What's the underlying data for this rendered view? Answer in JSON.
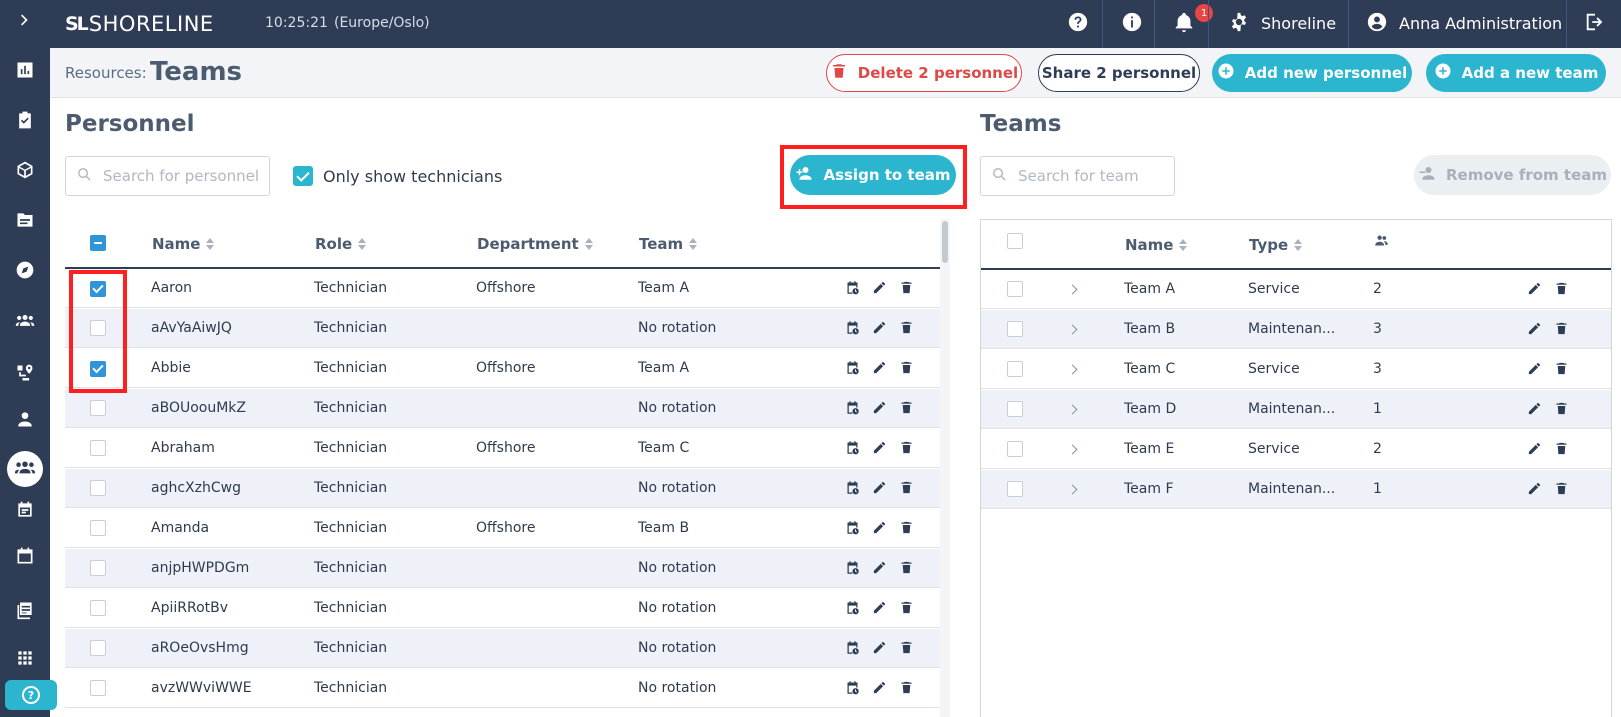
{
  "header": {
    "brand": "SHORELINE",
    "logo_mark": "SL",
    "time": "10:25:21",
    "timezone": "(Europe/Oslo)",
    "notification_count": "1",
    "org_name": "Shoreline",
    "user_name": "Anna Administration"
  },
  "page": {
    "breadcrumb_label": "Resources:",
    "title": "Teams"
  },
  "actions": {
    "delete_label": "Delete 2 personnel",
    "share_label": "Share 2 personnel",
    "add_personnel_label": "Add new personnel",
    "add_team_label": "Add a new team"
  },
  "personnel": {
    "title": "Personnel",
    "search_placeholder": "Search for personnel",
    "only_technicians_label": "Only show technicians",
    "assign_label": "Assign to team",
    "columns": {
      "name": "Name",
      "role": "Role",
      "department": "Department",
      "team": "Team"
    },
    "rows": [
      {
        "name": "Aaron",
        "role": "Technician",
        "department": "Offshore",
        "team": "Team A",
        "checked": true
      },
      {
        "name": "aAvYaAiwJQ",
        "role": "Technician",
        "department": "",
        "team": "No rotation",
        "checked": false
      },
      {
        "name": "Abbie",
        "role": "Technician",
        "department": "Offshore",
        "team": "Team A",
        "checked": true
      },
      {
        "name": "aBOUoouMkZ",
        "role": "Technician",
        "department": "",
        "team": "No rotation",
        "checked": false
      },
      {
        "name": "Abraham",
        "role": "Technician",
        "department": "Offshore",
        "team": "Team C",
        "checked": false
      },
      {
        "name": "aghcXzhCwg",
        "role": "Technician",
        "department": "",
        "team": "No rotation",
        "checked": false
      },
      {
        "name": "Amanda",
        "role": "Technician",
        "department": "Offshore",
        "team": "Team B",
        "checked": false
      },
      {
        "name": "anjpHWPDGm",
        "role": "Technician",
        "department": "",
        "team": "No rotation",
        "checked": false
      },
      {
        "name": "ApiiRRotBv",
        "role": "Technician",
        "department": "",
        "team": "No rotation",
        "checked": false
      },
      {
        "name": "aROeOvsHmg",
        "role": "Technician",
        "department": "",
        "team": "No rotation",
        "checked": false
      },
      {
        "name": "avzWWviWWE",
        "role": "Technician",
        "department": "",
        "team": "No rotation",
        "checked": false
      }
    ]
  },
  "teams": {
    "title": "Teams",
    "search_placeholder": "Search for team",
    "remove_label": "Remove from team",
    "columns": {
      "name": "Name",
      "type": "Type"
    },
    "rows": [
      {
        "name": "Team A",
        "type": "Service",
        "count": "2"
      },
      {
        "name": "Team B",
        "type": "Maintenan...",
        "count": "3"
      },
      {
        "name": "Team C",
        "type": "Service",
        "count": "3"
      },
      {
        "name": "Team D",
        "type": "Maintenan...",
        "count": "1"
      },
      {
        "name": "Team E",
        "type": "Service",
        "count": "2"
      },
      {
        "name": "Team F",
        "type": "Maintenan...",
        "count": "1"
      }
    ]
  },
  "colors": {
    "navy": "#2e3d55",
    "accent": "#2bb5cf",
    "danger": "#e04848",
    "highlight": "#ff1f1f"
  },
  "icons": {
    "sidebar": [
      "expand-chevron-icon",
      "dashboard-icon",
      "tasks-icon",
      "box-icon",
      "folder-icon",
      "compass-icon",
      "teams-icon",
      "route-icon",
      "person-icon",
      "teams-active-icon",
      "planner-icon",
      "calendar-icon",
      "reports-icon",
      "apps-grid-icon",
      "help-icon"
    ],
    "row_actions": [
      "schedule-icon",
      "edit-icon",
      "delete-icon"
    ]
  }
}
